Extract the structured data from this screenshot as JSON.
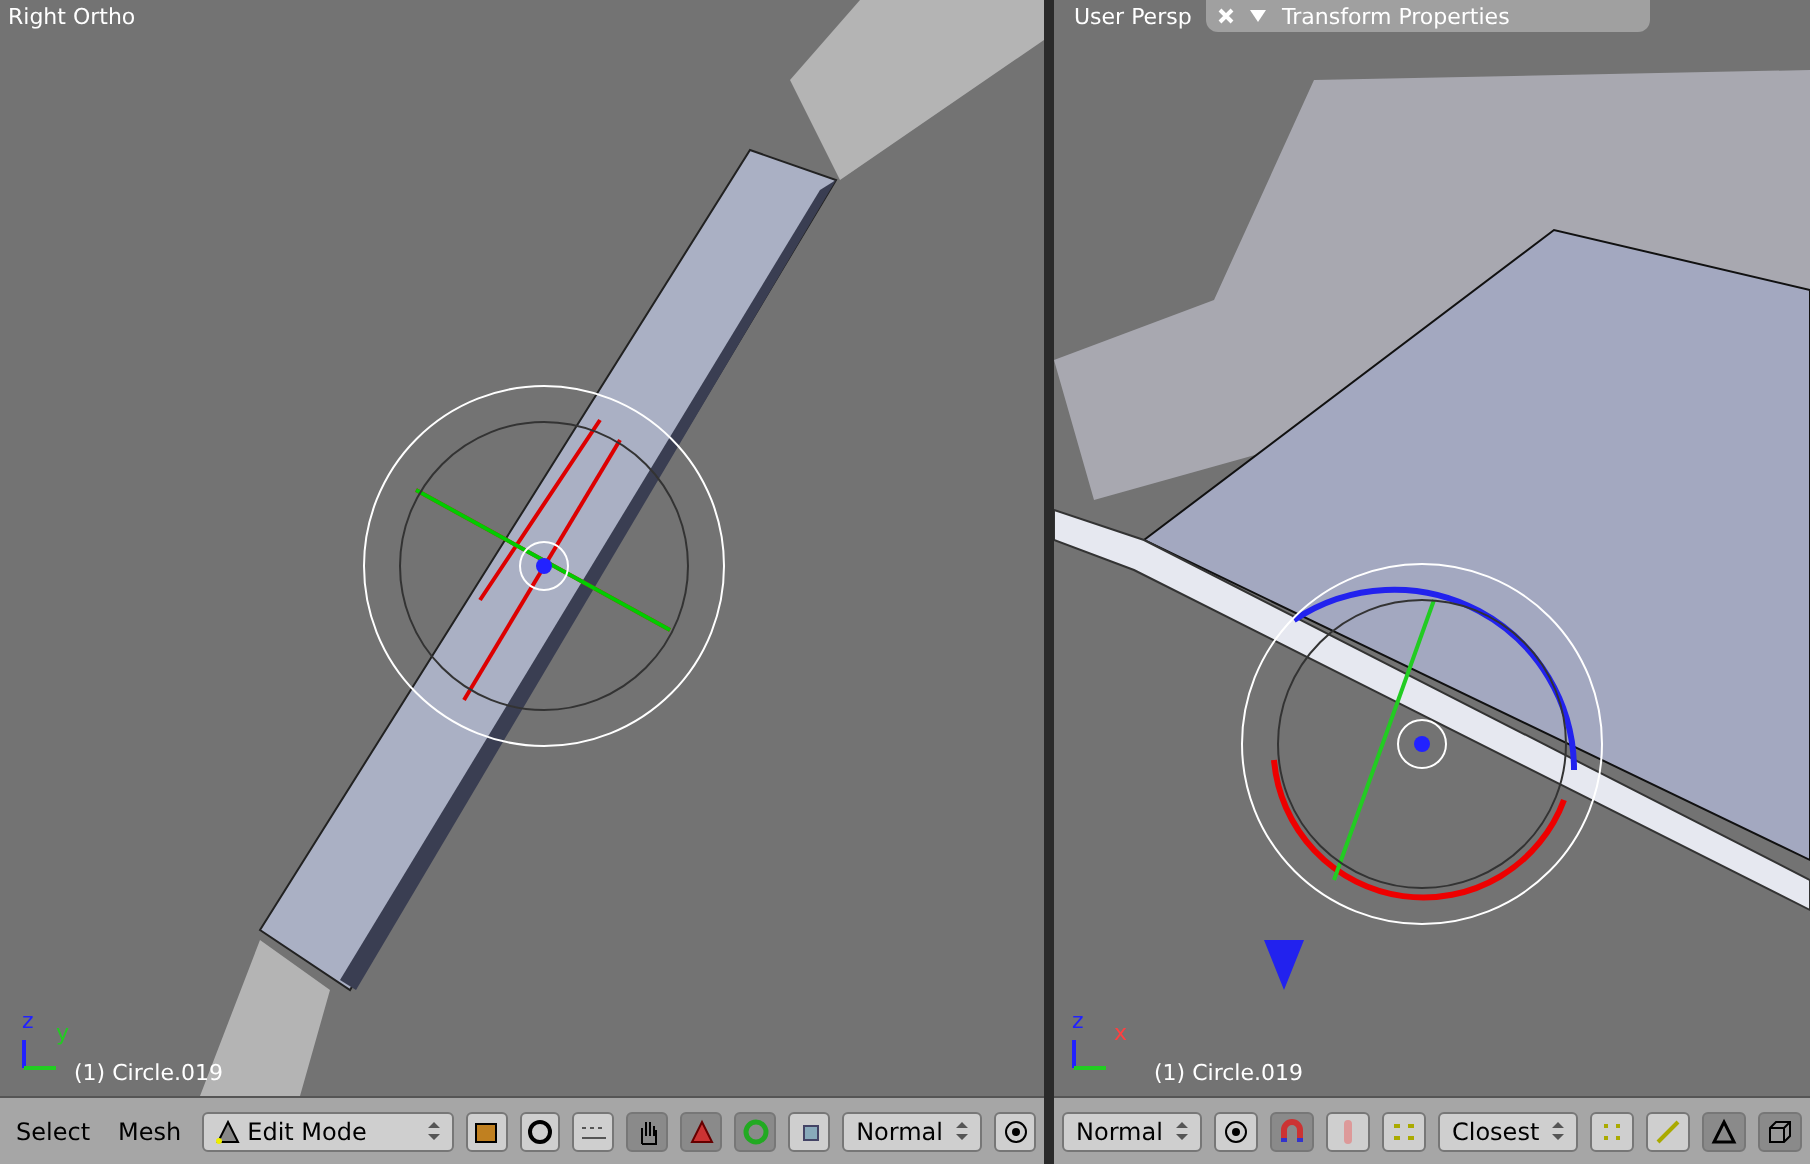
{
  "viewports": [
    {
      "label": "Right Ortho",
      "object": "(1) Circle.019",
      "axes": [
        "z",
        "y"
      ]
    },
    {
      "label": "User Persp",
      "object": "(1) Circle.019",
      "axes": [
        "z",
        "x"
      ],
      "panel": {
        "title": "Transform Properties",
        "expanded": true
      }
    }
  ],
  "headers": [
    {
      "items": [
        {
          "kind": "menu",
          "label": "Select"
        },
        {
          "kind": "menu",
          "label": "Mesh"
        },
        {
          "kind": "mode",
          "label": "Edit Mode"
        },
        {
          "kind": "object",
          "pressed": false
        },
        {
          "kind": "pivot",
          "pressed": false
        },
        {
          "kind": "grid",
          "pressed": false
        },
        {
          "kind": "hand",
          "pressed": true
        },
        {
          "kind": "move",
          "pressed": true
        },
        {
          "kind": "rotate",
          "pressed": true
        },
        {
          "kind": "scale",
          "pressed": false
        },
        {
          "kind": "select",
          "label": "Normal"
        },
        {
          "kind": "layer",
          "pressed": false
        }
      ]
    },
    {
      "items": [
        {
          "kind": "select",
          "label": "Normal"
        },
        {
          "kind": "layer",
          "pressed": false
        },
        {
          "kind": "magnet",
          "pressed": true
        },
        {
          "kind": "proportional",
          "pressed": false
        },
        {
          "kind": "snap",
          "pressed": false
        },
        {
          "kind": "select",
          "label": "Closest"
        },
        {
          "kind": "vertex",
          "pressed": false
        },
        {
          "kind": "edge",
          "pressed": false
        },
        {
          "kind": "face",
          "pressed": true
        },
        {
          "kind": "occlude",
          "pressed": true
        }
      ]
    }
  ]
}
